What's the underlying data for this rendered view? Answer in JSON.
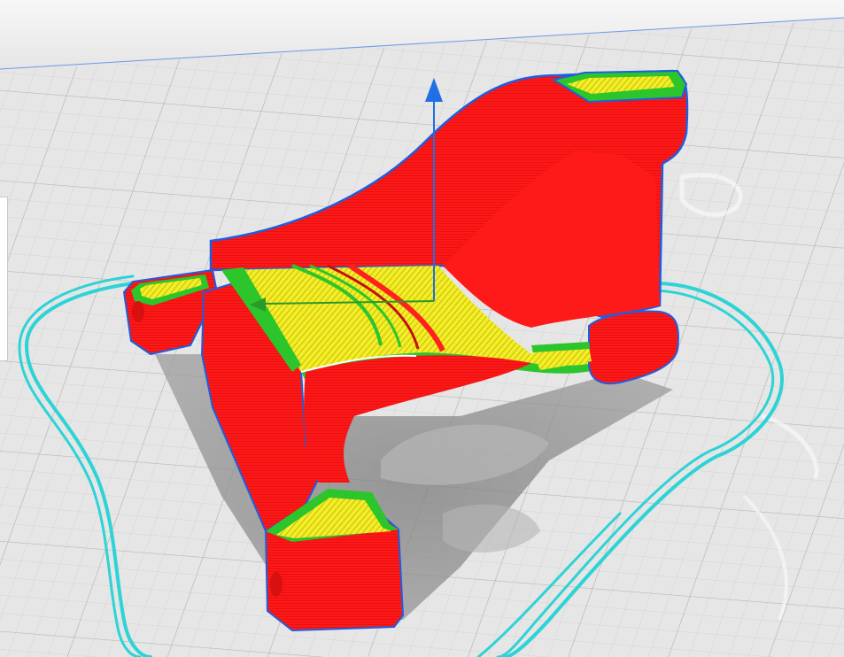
{
  "app": {
    "view": "layer-preview"
  },
  "colors": {
    "background_top": "#f4f4f4",
    "build_plate": "#e4e4e4",
    "grid_minor": "#d2d2d2",
    "grid_major": "#bcbcbc",
    "wall_outer": "#ff1a1a",
    "wall_inner": "#22c322",
    "infill": "#f2ef24",
    "outline": "#1e5ee0",
    "skirt": "#2ed3d6",
    "shadow": "#8a8a8a",
    "gizmo_axis_z": "#1f6fe6",
    "gizmo_axis_x": "#2a9a2a"
  },
  "icons": {
    "move_gizmo_z": "arrow-up-icon",
    "move_gizmo_x": "arrow-left-icon"
  }
}
